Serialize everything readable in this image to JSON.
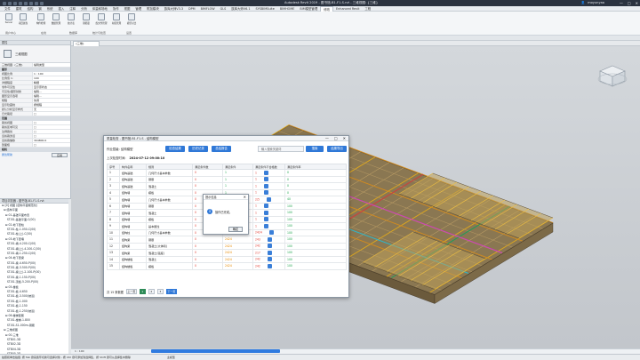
{
  "app": {
    "title": "Autodesk Revit 2019 - 图书馆-B1-F1-S.rvt - 三维视图: {三维}",
    "user": "moyunyaa",
    "window_controls": [
      "—",
      "□",
      "✕"
    ]
  },
  "menu": [
    "文件",
    "建筑",
    "结构",
    "钢",
    "系统",
    "插入",
    "注释",
    "分析",
    "体量和场地",
    "协作",
    "视图",
    "管理",
    "附加模块",
    "族库大师V3.3",
    "DPM",
    "BIMFLOW",
    "GLS",
    "族库大师V6.1",
    "SYSBIMSuite",
    "BIMHOME",
    "BIM模型管理",
    "修改",
    "Enhanced Revit",
    "工程"
  ],
  "menu_active_index": 21,
  "ribbon": {
    "buttons": [
      "Server",
      "项目属性",
      "构件检测",
      "数据管理",
      "统计表",
      "钢筋量",
      "族文件管理",
      "材质管理",
      "模型对比"
    ],
    "groups": [
      "用户中心",
      "在线",
      "数据库",
      "统计与检查",
      "设置"
    ]
  },
  "properties": {
    "header": "属性",
    "type_name": "三维视图",
    "view_label": "三维视图: {三维}",
    "edit_type": "编辑类型",
    "section_graphics": "图形",
    "rows": [
      {
        "k": "视图比例",
        "v": "1 : 100"
      },
      {
        "k": "比例值 1:",
        "v": "100"
      },
      {
        "k": "详细程度",
        "v": "精细"
      },
      {
        "k": "零件可见性",
        "v": "显示原状态"
      },
      {
        "k": "可见性/图形替换",
        "v": "编辑..."
      },
      {
        "k": "图形显示选项",
        "v": "编辑..."
      },
      {
        "k": "规程",
        "v": "协调"
      },
      {
        "k": "显示隐藏线",
        "v": "按规程"
      },
      {
        "k": "默认分析显示样式",
        "v": "无"
      },
      {
        "k": "日光路径",
        "v": "□"
      }
    ],
    "section_extents": "范围",
    "rows2": [
      {
        "k": "裁剪视图",
        "v": "□"
      },
      {
        "k": "裁剪区域可见",
        "v": "□"
      },
      {
        "k": "注释裁剪",
        "v": "□"
      },
      {
        "k": "远剪裁激活",
        "v": "□"
      },
      {
        "k": "远剪裁偏移",
        "v": "304800.0"
      },
      {
        "k": "剖面框",
        "v": "□"
      }
    ],
    "section_camera": "相机",
    "apply": "应用",
    "help_link": "属性帮助"
  },
  "browser": {
    "header": "项目浏览器 - 图书馆-B1-F1-S.rvt",
    "items": [
      "⊟ [0] 视图 (结构平面规范化)",
      "  ⊟ 结构平面",
      "    ⊟ 01-基础平面布置",
      "      ST-B1-基础平面-C(00)",
      "    ⊟ 02-地下室柱",
      "      ST-B1-柱-1.050-C(00)",
      "      ST-B1-柱(上)-C(00)",
      "    ⊟ 03-地下室墙",
      "      ST-B1-墙-4.200-C(00)",
      "      ST-B1-墙(上)-4.200-C(00)",
      "      ST-B1-墙-1.250-C(00)",
      "    ⊟ 04-地下室梁",
      "      ST-B1-梁-4.650-P(00)",
      "      ST-B1-梁-3.500-P(00)",
      "      ST-B1-梁(上)-2.100-P(00)",
      "      ST-B1-梁-1.150-P(00)",
      "      ST-B1-顶板-5.200-P(00)",
      "    ⊟ 05-楼板",
      "      ST-B1-板-4.650",
      "      ST-B1-板-3.500(坡道)",
      "      ST-B1-板-1.000",
      "      ST-B1-板-1.150",
      "      ST-B1-板-1.250(坡道)",
      "    ⊟ 06-楼梯配筋",
      "      ST-B1-楼梯-1.800",
      "      ST-B1-S1-000m-钢筋",
      "  ⊟ 三维视图",
      "    ⊟ 00-三维",
      "      STB01-3D",
      "      STB02-3D",
      "      STB04-3D",
      "      STB05-3D",
      "      {三维}"
    ]
  },
  "view_tab": "{三维}",
  "dialog": {
    "title": "质量检查 - 图书馆-B1-F1-S - 结构模型",
    "row1": {
      "label_prefix": "作业层级:",
      "value": "结构模型",
      "btn_check": "检查结果",
      "btn_history": "历史记录",
      "btn_summary": "总结报告",
      "search_placeholder": "输入搜索关键词",
      "btn_search": "搜索",
      "btn_export": "结果导出"
    },
    "date_label": "上次检查时间:",
    "date_value": "2024-07-12 09:00:10",
    "columns": [
      "序号",
      "构件名称",
      "规则",
      "满足条件数",
      "满足条件",
      "满足条件不合格数",
      "满足条件率"
    ],
    "rows": [
      {
        "no": "1",
        "name": "结构基础",
        "rule": "几何尺寸基本参数",
        "a": "0",
        "b": "1",
        "c": "1",
        "d": "0"
      },
      {
        "no": "2",
        "name": "结构基础",
        "rule": "钢筋",
        "a": "0",
        "b": "1",
        "c": "1",
        "d": "0"
      },
      {
        "no": "3",
        "name": "结构基础",
        "rule": "混凝土",
        "a": "0",
        "b": "1",
        "c": "1",
        "d": "0"
      },
      {
        "no": "4",
        "name": "结构墙",
        "rule": "模板",
        "a": "0",
        "b": "1",
        "c": "1",
        "d": "0"
      },
      {
        "no": "5",
        "name": "结构墙",
        "rule": "几何尺寸基本参数",
        "a": "0",
        "b": "1",
        "c": "2/5",
        "d": "40"
      },
      {
        "no": "6",
        "name": "结构墙",
        "rule": "钢筋",
        "a": "0",
        "b": "1",
        "c": "1",
        "d": "100"
      },
      {
        "no": "7",
        "name": "结构墙",
        "rule": "混凝土",
        "a": "0",
        "b": "1",
        "c": "1",
        "d": "100"
      },
      {
        "no": "8",
        "name": "结构墙",
        "rule": "模板",
        "a": "0",
        "b": "1",
        "c": "1",
        "d": "100"
      },
      {
        "no": "9",
        "name": "结构墙",
        "rule": "基本属性",
        "a": "0",
        "b": "1",
        "c": "1",
        "d": "100"
      },
      {
        "no": "10",
        "name": "结构柱",
        "rule": "几何尺寸基本参数",
        "a": "0",
        "b": "2424",
        "c": "2424",
        "d": "100"
      },
      {
        "no": "11",
        "name": "结构梁",
        "rule": "钢筋",
        "a": "0",
        "b": "2424",
        "c": "243",
        "d": "100"
      },
      {
        "no": "12",
        "name": "结构梁",
        "rule": "混凝土(大体积)",
        "a": "0",
        "b": "2424",
        "c": "242",
        "d": "100"
      },
      {
        "no": "13",
        "name": "结构梁",
        "rule": "混凝土(强度)",
        "a": "0",
        "b": "2424",
        "c": "217",
        "d": "100"
      },
      {
        "no": "14",
        "name": "结构楼板",
        "rule": "混凝土",
        "a": "0",
        "b": "2424",
        "c": "242",
        "d": "100"
      },
      {
        "no": "15",
        "name": "结构楼板",
        "rule": "模板",
        "a": "0",
        "b": "2424",
        "c": "242",
        "d": "100"
      }
    ],
    "pager": {
      "total": "共 15 条数据",
      "prev": "上一页",
      "pages": [
        "1",
        "2",
        "3"
      ],
      "next": "下一页"
    }
  },
  "alert": {
    "title": "提示信息",
    "message": "操作已完成。",
    "ok": "确定"
  },
  "status": {
    "text": "拍照和单击拍摄. 按 Tab 键来循环切换可选择对象 - 按 Ctrl 键可添加到选择集，按 Shift 键可从选择集中删除",
    "view_controls": "1 : 100",
    "model": "主模型"
  },
  "colors": {
    "accent": "#2f78d7",
    "titlebar": "#2b3340",
    "red": "#e03a2f",
    "green": "#1aa34a",
    "orange": "#e68a00"
  }
}
